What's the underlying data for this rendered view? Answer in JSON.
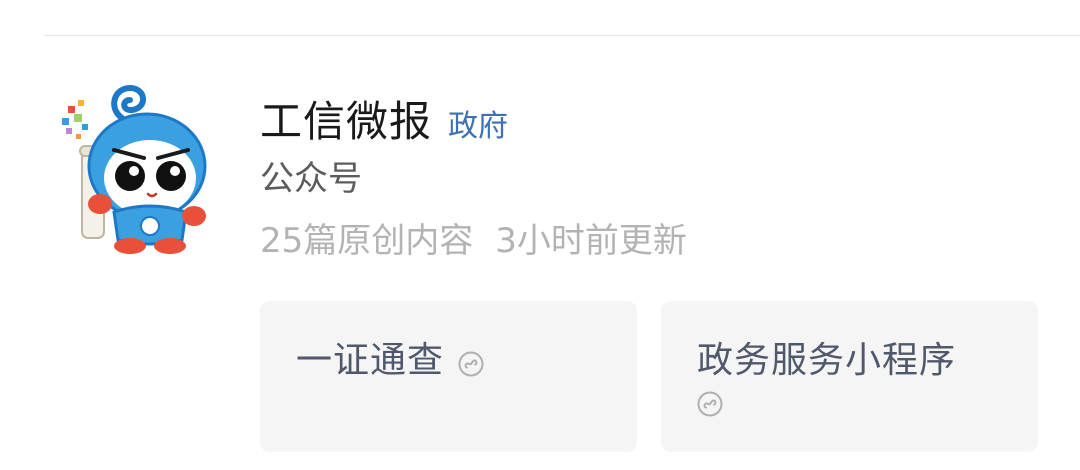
{
  "account": {
    "name": "工信微报",
    "tag": "政府",
    "type": "公众号",
    "stats_original": "25篇原创内容",
    "stats_updated": "3小时前更新"
  },
  "mini_programs": [
    {
      "label": "一证通查",
      "icon": "mini-program-icon"
    },
    {
      "label": "政务服务小程序",
      "icon": "mini-program-icon"
    }
  ],
  "colors": {
    "tag_blue": "#3f70b4",
    "card_bg": "#f5f5f5",
    "card_text": "#50586c",
    "stats_text": "#b3b3b3"
  }
}
